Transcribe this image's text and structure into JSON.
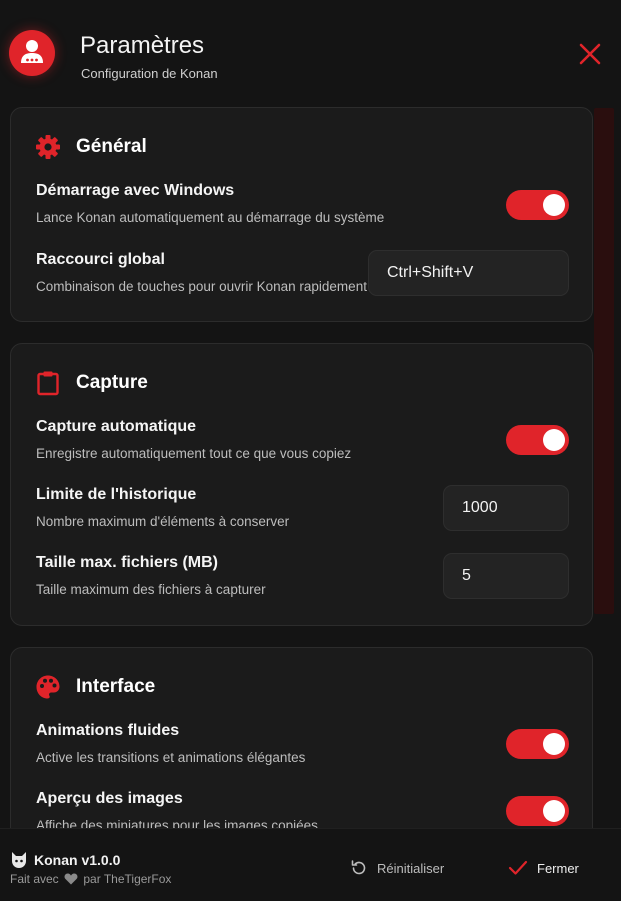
{
  "header": {
    "title": "Paramètres",
    "subtitle": "Configuration de Konan",
    "avatar_icon": "user-icon",
    "close_icon": "close-icon"
  },
  "sections": {
    "general": {
      "title": "Général",
      "icon": "gear-icon",
      "startup": {
        "label": "Démarrage avec Windows",
        "desc": "Lance Konan automatiquement au démarrage du système",
        "enabled": true
      },
      "shortcut": {
        "label": "Raccourci global",
        "desc": "Combinaison de touches pour ouvrir Konan rapidement",
        "value": "Ctrl+Shift+V"
      }
    },
    "capture": {
      "title": "Capture",
      "icon": "clipboard-icon",
      "auto": {
        "label": "Capture automatique",
        "desc": "Enregistre automatiquement tout ce que vous copiez",
        "enabled": true
      },
      "history_limit": {
        "label": "Limite de l'historique",
        "desc": "Nombre maximum d'éléments à conserver",
        "value": "1000"
      },
      "max_file_size": {
        "label": "Taille max. fichiers (MB)",
        "desc": "Taille maximum des fichiers à capturer",
        "value": "5"
      }
    },
    "interface": {
      "title": "Interface",
      "icon": "palette-icon",
      "animations": {
        "label": "Animations fluides",
        "desc": "Active les transitions et animations élégantes",
        "enabled": true
      },
      "image_preview": {
        "label": "Aperçu des images",
        "desc": "Affiche des miniatures pour les images copiées",
        "enabled": true
      }
    }
  },
  "footer": {
    "app_name": "Konan v1.0.0",
    "made_with": "Fait avec",
    "made_by": "par TheTigerFox",
    "reset_label": "Réinitialiser",
    "close_label": "Fermer"
  },
  "colors": {
    "accent": "#e0242a",
    "background": "#141414",
    "card": "#1b1b1b"
  }
}
